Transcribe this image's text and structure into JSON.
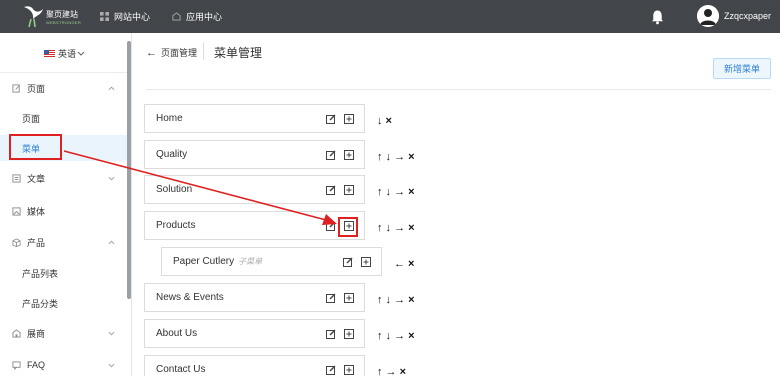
{
  "header": {
    "logo_text": "聚页建站",
    "logo_sub": "WEBSTRONGER",
    "nav": [
      {
        "label": "网站中心"
      },
      {
        "label": "应用中心"
      }
    ],
    "username": "Zzqcxpaper"
  },
  "sidebar": {
    "language": "英语",
    "items": [
      {
        "label": "页面",
        "icon": "document-edit-icon",
        "expandable": true
      },
      {
        "label": "页面"
      },
      {
        "label": "菜单"
      },
      {
        "label": "文章",
        "icon": "article-icon",
        "expandable": true
      },
      {
        "label": "媒体",
        "icon": "image-icon"
      },
      {
        "label": "产品",
        "icon": "box-icon",
        "expandable": true
      },
      {
        "label": "产品列表"
      },
      {
        "label": "产品分类"
      },
      {
        "label": "展商",
        "icon": "building-icon",
        "expandable": true
      },
      {
        "label": "FAQ",
        "icon": "faq-icon",
        "expandable": true
      }
    ]
  },
  "main": {
    "breadcrumb_back": "页面管理",
    "title": "菜单管理",
    "add_button": "新增菜单",
    "menus": [
      {
        "label": "Home",
        "actions": "↓ ×"
      },
      {
        "label": "Quality",
        "actions": "↑ ↓ → ×"
      },
      {
        "label": "Solution",
        "actions": "↑ ↓ → ×"
      },
      {
        "label": "Products",
        "actions": "↑ ↓ → ×"
      },
      {
        "label": "Paper Cutlery",
        "tag": "子菜单",
        "actions": "← ×"
      },
      {
        "label": "News & Events",
        "actions": "↑ ↓ → ×"
      },
      {
        "label": "About Us",
        "actions": "↑ ↓ → ×"
      },
      {
        "label": "Contact Us",
        "actions": "↑ → ×"
      }
    ]
  },
  "colors": {
    "topbar": "#42454a",
    "accent": "#2b7fd1",
    "highlight": "#e02020"
  }
}
